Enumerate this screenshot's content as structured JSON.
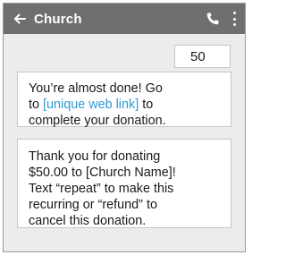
{
  "header": {
    "title": "Church",
    "back_icon": "arrow-left-icon",
    "call_icon": "phone-icon",
    "menu_icon": "more-vertical-icon",
    "bar_color": "#6f6f6f",
    "link_color": "#2f9bd6"
  },
  "messages": {
    "sent": {
      "text": "50"
    },
    "received_1": {
      "line1": "You’re almost done! Go",
      "line2_prefix": "to ",
      "link_text": "[unique web link]",
      "line2_suffix": " to",
      "line3": "complete your donation."
    },
    "received_2": {
      "line1": "Thank you for donating",
      "line2": "$50.00 to [Church Name]!",
      "line3": "Text “repeat” to make this",
      "line4": "recurring or “refund” to",
      "line5": "cancel this donation."
    }
  }
}
